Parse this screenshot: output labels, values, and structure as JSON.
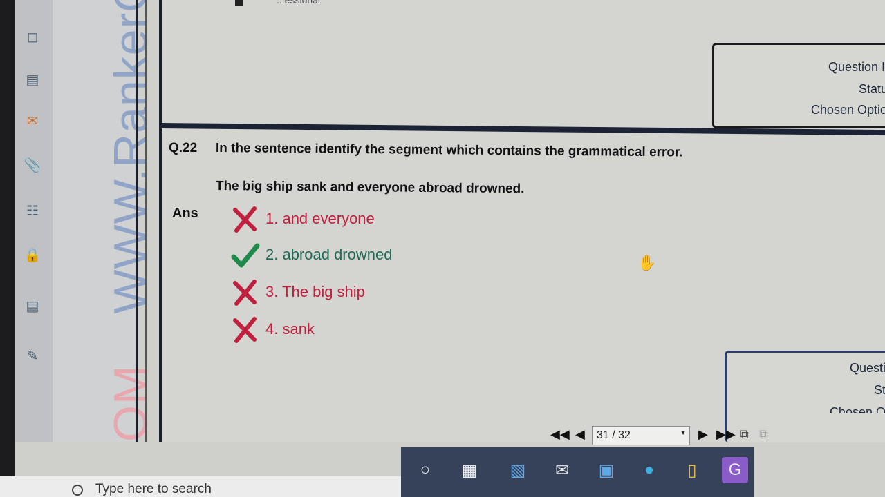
{
  "watermark": {
    "prefix": "OM",
    "text": "WWW.RankerG.C"
  },
  "top_strip": {
    "text": "...essional"
  },
  "question_info_panel": {
    "rows": [
      "Question ID",
      "Status",
      "Chosen Option"
    ]
  },
  "question_info_panel_2": {
    "rows": [
      "Questio",
      "Sta",
      "Chosen Op"
    ]
  },
  "question": {
    "number": "Q.22",
    "text": "In the sentence identify the segment which contains the grammatical error.",
    "sentence": "The big ship sank and everyone abroad drowned.",
    "answer_label": "Ans",
    "options": [
      {
        "label": "1. and everyone",
        "status": "wrong"
      },
      {
        "label": "2. abroad drowned",
        "status": "correct"
      },
      {
        "label": "3. The big ship",
        "status": "wrong"
      },
      {
        "label": "4. sank",
        "status": "wrong"
      }
    ]
  },
  "pager": {
    "value": "31 / 32"
  },
  "search": {
    "placeholder": "Type here to search"
  },
  "colors": {
    "wrong": "#c0203e",
    "correct": "#1f8a4a",
    "taskbar": "#36425a"
  }
}
